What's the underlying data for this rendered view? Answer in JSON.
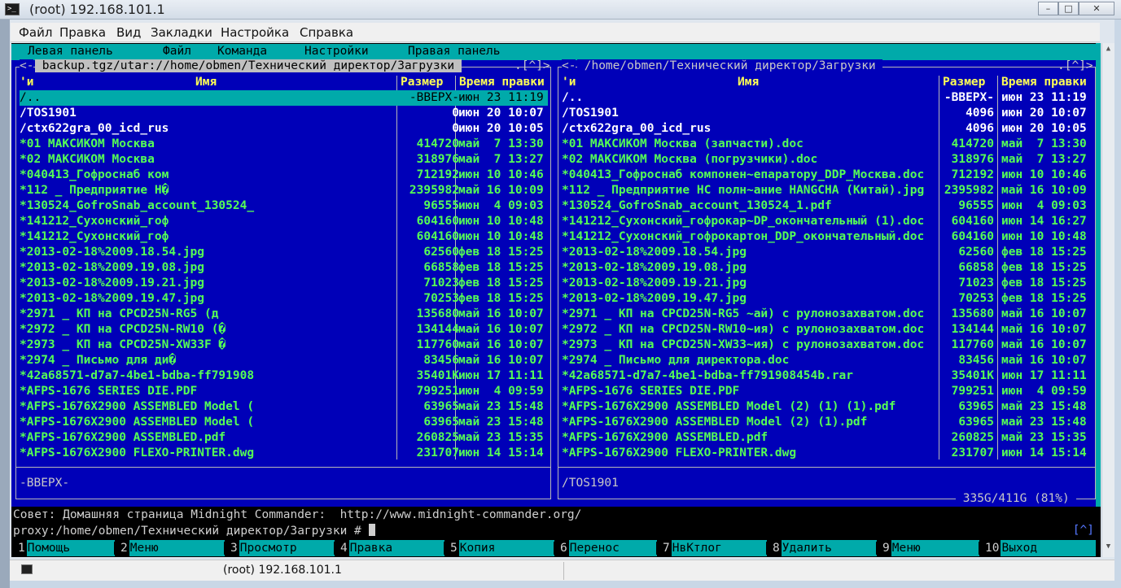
{
  "window": {
    "title": "(root) 192.168.101.1"
  },
  "menubar": [
    "Файл",
    "Правка",
    "Вид",
    "Закладки",
    "Настройка",
    "Справка"
  ],
  "mc_menu": [
    "Левая панель",
    "Файл",
    "Команда",
    "Настройки",
    "Правая панель"
  ],
  "left_panel": {
    "title_prefix": "<-",
    "title": " backup.tgz/utar://home/obmen/Технический директор/Загрузки ",
    "title_tail": ".[^]>",
    "col_sort": "'и",
    "col_name": "Имя",
    "col_size": "Размер",
    "col_time": "Время правки",
    "mini_status": "-ВВЕРХ-",
    "rows": [
      {
        "name": "/..",
        "size": "-ВВЕРХ-",
        "time": "июн 23 11:19",
        "kind": "sel"
      },
      {
        "name": "/TOS1901",
        "size": "0",
        "time": "июн 20 10:07",
        "kind": "dir"
      },
      {
        "name": "/ctx622gra_00_icd_rus",
        "size": "0",
        "time": "июн 20 10:05",
        "kind": "dir"
      },
      {
        "name": "*01 МАКСИКОМ Москва",
        "size": "414720",
        "time": "май  7 13:30",
        "kind": "exe"
      },
      {
        "name": "*02 МАКСИКОМ Москва",
        "size": "318976",
        "time": "май  7 13:27",
        "kind": "exe"
      },
      {
        "name": "*040413_Гофроснаб ком",
        "size": "712192",
        "time": "июн 10 10:46",
        "kind": "exe"
      },
      {
        "name": "*112 _ Предприятие Н�",
        "size": "2395982",
        "time": "май 16 10:09",
        "kind": "exe"
      },
      {
        "name": "*130524_GofroSnab_account_130524_",
        "size": "96555",
        "time": "июн  4 09:03",
        "kind": "exe"
      },
      {
        "name": "*141212_Сухонский_гоф",
        "size": "604160",
        "time": "июн 10 10:48",
        "kind": "exe"
      },
      {
        "name": "*141212_Сухонский_гоф",
        "size": "604160",
        "time": "июн 10 10:48",
        "kind": "exe"
      },
      {
        "name": "*2013-02-18%2009.18.54.jpg",
        "size": "62560",
        "time": "фев 18 15:25",
        "kind": "exe"
      },
      {
        "name": "*2013-02-18%2009.19.08.jpg",
        "size": "66858",
        "time": "фев 18 15:25",
        "kind": "exe"
      },
      {
        "name": "*2013-02-18%2009.19.21.jpg",
        "size": "71023",
        "time": "фев 18 15:25",
        "kind": "exe"
      },
      {
        "name": "*2013-02-18%2009.19.47.jpg",
        "size": "70253",
        "time": "фев 18 15:25",
        "kind": "exe"
      },
      {
        "name": "*2971 _ КП на CPCD25N-RG5 (д",
        "size": "135680",
        "time": "май 16 10:07",
        "kind": "exe"
      },
      {
        "name": "*2972 _ КП на CPCD25N-RW10 (�",
        "size": "134144",
        "time": "май 16 10:07",
        "kind": "exe"
      },
      {
        "name": "*2973 _ КП на CPCD25N-XW33F �",
        "size": "117760",
        "time": "май 16 10:07",
        "kind": "exe"
      },
      {
        "name": "*2974 _ Письмо для ди�",
        "size": "83456",
        "time": "май 16 10:07",
        "kind": "exe"
      },
      {
        "name": "*42a68571-d7a7-4be1-bdba-ff791908",
        "size": "35401K",
        "time": "июн 17 11:11",
        "kind": "exe"
      },
      {
        "name": "*AFPS-1676 SERIES DIE.PDF",
        "size": "799251",
        "time": "июн  4 09:59",
        "kind": "exe"
      },
      {
        "name": "*AFPS-1676X2900 ASSEMBLED Model (",
        "size": "63965",
        "time": "май 23 15:48",
        "kind": "exe"
      },
      {
        "name": "*AFPS-1676X2900 ASSEMBLED Model (",
        "size": "63965",
        "time": "май 23 15:48",
        "kind": "exe"
      },
      {
        "name": "*AFPS-1676X2900 ASSEMBLED.pdf",
        "size": "260825",
        "time": "май 23 15:35",
        "kind": "exe"
      },
      {
        "name": "*AFPS-1676X2900 FLEXO-PRINTER.dwg",
        "size": "231707",
        "time": "июн 14 15:14",
        "kind": "exe"
      }
    ]
  },
  "right_panel": {
    "title_prefix": "<-",
    "title": " /home/obmen/Технический директор/Загрузки ",
    "title_tail": ".[^]>",
    "col_sort": "'и",
    "col_name": "Имя",
    "col_size": "Размер",
    "col_time": "Время правки",
    "mini_status": "/TOS1901",
    "disk_usage": " 335G/411G (81%) ",
    "rows": [
      {
        "name": "/..",
        "size": "-ВВЕРХ-",
        "time": "июн 23 11:19",
        "kind": "dir"
      },
      {
        "name": "/TOS1901",
        "size": "4096",
        "time": "июн 20 10:07",
        "kind": "dir"
      },
      {
        "name": "/ctx622gra_00_icd_rus",
        "size": "4096",
        "time": "июн 20 10:05",
        "kind": "dir"
      },
      {
        "name": "*01 МАКСИКОМ Москва (запчасти).doc",
        "size": "414720",
        "time": "май  7 13:30",
        "kind": "exe"
      },
      {
        "name": "*02 МАКСИКОМ Москва (погрузчики).doc",
        "size": "318976",
        "time": "май  7 13:27",
        "kind": "exe"
      },
      {
        "name": "*040413_Гофроснаб компонен~епаратору_DDP_Москва.doc",
        "size": "712192",
        "time": "июн 10 10:46",
        "kind": "exe"
      },
      {
        "name": "*112 _ Предприятие НС полн~ание HANGCHA (Китай).jpg",
        "size": "2395982",
        "time": "май 16 10:09",
        "kind": "exe"
      },
      {
        "name": "*130524_GofroSnab_account_130524_1.pdf",
        "size": "96555",
        "time": "июн  4 09:03",
        "kind": "exe"
      },
      {
        "name": "*141212_Сухонский_гофрокар~DP_окончательный (1).doc",
        "size": "604160",
        "time": "июн 14 16:27",
        "kind": "exe"
      },
      {
        "name": "*141212_Сухонский_гофрокартон_DDP_окончательный.doc",
        "size": "604160",
        "time": "июн 10 10:48",
        "kind": "exe"
      },
      {
        "name": "*2013-02-18%2009.18.54.jpg",
        "size": "62560",
        "time": "фев 18 15:25",
        "kind": "exe"
      },
      {
        "name": "*2013-02-18%2009.19.08.jpg",
        "size": "66858",
        "time": "фев 18 15:25",
        "kind": "exe"
      },
      {
        "name": "*2013-02-18%2009.19.21.jpg",
        "size": "71023",
        "time": "фев 18 15:25",
        "kind": "exe"
      },
      {
        "name": "*2013-02-18%2009.19.47.jpg",
        "size": "70253",
        "time": "фев 18 15:25",
        "kind": "exe"
      },
      {
        "name": "*2971 _ КП на CPCD25N-RG5 ~ай) с рулонозахватом.doc",
        "size": "135680",
        "time": "май 16 10:07",
        "kind": "exe"
      },
      {
        "name": "*2972 _ КП на CPCD25N-RW10~ия) с рулонозахватом.doc",
        "size": "134144",
        "time": "май 16 10:07",
        "kind": "exe"
      },
      {
        "name": "*2973 _ КП на CPCD25N-XW33~ия) с рулонозахватом.doc",
        "size": "117760",
        "time": "май 16 10:07",
        "kind": "exe"
      },
      {
        "name": "*2974 _ Письмо для директора.doc",
        "size": "83456",
        "time": "май 16 10:07",
        "kind": "exe"
      },
      {
        "name": "*42a68571-d7a7-4be1-bdba-ff791908454b.rar",
        "size": "35401K",
        "time": "июн 17 11:11",
        "kind": "exe"
      },
      {
        "name": "*AFPS-1676 SERIES DIE.PDF",
        "size": "799251",
        "time": "июн  4 09:59",
        "kind": "exe"
      },
      {
        "name": "*AFPS-1676X2900 ASSEMBLED Model (2) (1) (1).pdf",
        "size": "63965",
        "time": "май 23 15:48",
        "kind": "exe"
      },
      {
        "name": "*AFPS-1676X2900 ASSEMBLED Model (2) (1).pdf",
        "size": "63965",
        "time": "май 23 15:48",
        "kind": "exe"
      },
      {
        "name": "*AFPS-1676X2900 ASSEMBLED.pdf",
        "size": "260825",
        "time": "май 23 15:35",
        "kind": "exe"
      },
      {
        "name": "*AFPS-1676X2900 FLEXO-PRINTER.dwg",
        "size": "231707",
        "time": "июн 14 15:14",
        "kind": "exe"
      }
    ]
  },
  "hint": "Совет: Домашняя страница Midnight Commander:  http://www.midnight-commander.org/",
  "prompt": "proxy:/home/obmen/Технический директор/Загрузки # ",
  "prompt_tag": "[^]",
  "fkeys": [
    {
      "num": "1",
      "label": "Помощь"
    },
    {
      "num": "2",
      "label": "Меню"
    },
    {
      "num": "3",
      "label": "Просмотр"
    },
    {
      "num": "4",
      "label": "Правка"
    },
    {
      "num": "5",
      "label": "Копия"
    },
    {
      "num": "6",
      "label": "Перенос"
    },
    {
      "num": "7",
      "label": "НвКтлог"
    },
    {
      "num": "8",
      "label": "Удалить"
    },
    {
      "num": "9",
      "label": "Меню"
    },
    {
      "num": "10",
      "label": "Выход"
    }
  ],
  "taskbar": {
    "label": "(root) 192.168.101.1"
  },
  "colors": {
    "panel_bg": "#0000b8",
    "cyan": "#00aaaa",
    "exec": "#55ff55",
    "header": "#ffff55"
  }
}
